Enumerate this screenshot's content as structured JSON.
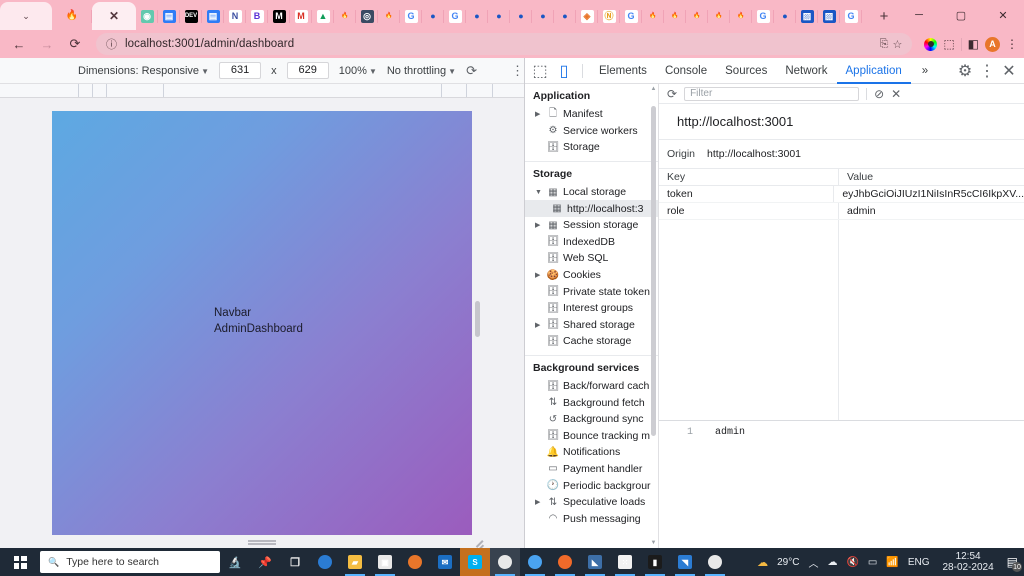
{
  "browser": {
    "tabs_left": [
      {
        "name": "tab-menu-chevron",
        "glyph": "⌄",
        "kind": "chevron"
      },
      {
        "name": "tab-pinned-1",
        "glyph": "🔥",
        "kind": "emoji"
      },
      {
        "name": "tab-active-close",
        "glyph": "✕",
        "kind": "close"
      }
    ],
    "pinned_tabs": [
      {
        "name": "tab-favicon-teal-circle",
        "label": "◉",
        "bg": "#63c9ae",
        "fg": "#ffffff"
      },
      {
        "name": "tab-favicon-docs-blue",
        "label": "▤",
        "bg": "#2f7cf6",
        "fg": "#ffffff"
      },
      {
        "name": "tab-favicon-dev-black",
        "label": "DEV",
        "bg": "#000000",
        "fg": "#ffffff"
      },
      {
        "name": "tab-favicon-docs-blue-2",
        "label": "▤",
        "bg": "#2f7cf6",
        "fg": "#ffffff"
      },
      {
        "name": "tab-favicon-notion-n",
        "label": "N",
        "bg": "#ffffff",
        "fg": "#3b4ea0"
      },
      {
        "name": "tab-favicon-bootstrap-b",
        "label": "B",
        "bg": "#ffffff",
        "fg": "#5b32d6"
      },
      {
        "name": "tab-favicon-medium-m",
        "label": "M",
        "bg": "#000000",
        "fg": "#ffffff"
      },
      {
        "name": "tab-favicon-gmail-m",
        "label": "M",
        "bg": "#ffffff",
        "fg": "#d93025"
      },
      {
        "name": "tab-favicon-google-drive",
        "label": "▲",
        "bg": "#ffffff",
        "fg": "#0f9d58"
      },
      {
        "name": "tab-favicon-fire-1",
        "label": "🔥",
        "bg": "transparent",
        "fg": "#e8762a"
      },
      {
        "name": "tab-favicon-camera-dark",
        "label": "◎",
        "bg": "#3b4a63",
        "fg": "#ffffff"
      },
      {
        "name": "tab-favicon-fire-2",
        "label": "🔥",
        "bg": "transparent",
        "fg": "#e8762a"
      },
      {
        "name": "tab-favicon-google-g-1",
        "label": "G",
        "bg": "#ffffff",
        "fg": "#4285f4"
      },
      {
        "name": "tab-favicon-blue-dot-1",
        "label": "●",
        "bg": "transparent",
        "fg": "#1a56c4"
      },
      {
        "name": "tab-favicon-google-g-2",
        "label": "G",
        "bg": "#ffffff",
        "fg": "#4285f4"
      },
      {
        "name": "tab-favicon-blue-dot-2",
        "label": "●",
        "bg": "transparent",
        "fg": "#1a56c4"
      },
      {
        "name": "tab-favicon-blue-dot-3",
        "label": "●",
        "bg": "transparent",
        "fg": "#1a56c4"
      },
      {
        "name": "tab-favicon-blue-dot-4",
        "label": "●",
        "bg": "transparent",
        "fg": "#1a56c4"
      },
      {
        "name": "tab-favicon-blue-dot-5",
        "label": "●",
        "bg": "transparent",
        "fg": "#1a56c4"
      },
      {
        "name": "tab-favicon-blue-dot-6",
        "label": "●",
        "bg": "transparent",
        "fg": "#1a56c4"
      },
      {
        "name": "tab-favicon-orange-diamond",
        "label": "◈",
        "bg": "#ffffff",
        "fg": "#e8762a"
      },
      {
        "name": "tab-favicon-orange-n",
        "label": "Ⓝ",
        "bg": "#ffffff",
        "fg": "#e8a020"
      },
      {
        "name": "tab-favicon-google-g-3",
        "label": "G",
        "bg": "#ffffff",
        "fg": "#4285f4"
      },
      {
        "name": "tab-favicon-fire-3",
        "label": "🔥",
        "bg": "transparent",
        "fg": "#e8a98d"
      },
      {
        "name": "tab-favicon-fire-4",
        "label": "🔥",
        "bg": "transparent",
        "fg": "#e8a98d"
      },
      {
        "name": "tab-favicon-fire-5",
        "label": "🔥",
        "bg": "transparent",
        "fg": "#e8a98d"
      },
      {
        "name": "tab-favicon-fire-6",
        "label": "🔥",
        "bg": "transparent",
        "fg": "#e8a98d"
      },
      {
        "name": "tab-favicon-fire-7",
        "label": "🔥",
        "bg": "transparent",
        "fg": "#e8a98d"
      },
      {
        "name": "tab-favicon-google-g-4",
        "label": "G",
        "bg": "#ffffff",
        "fg": "#4285f4"
      },
      {
        "name": "tab-favicon-blue-dot-7",
        "label": "●",
        "bg": "transparent",
        "fg": "#1a56c4"
      },
      {
        "name": "tab-favicon-blue-square-1",
        "label": "▨",
        "bg": "#1a56c4",
        "fg": "#ffffff"
      },
      {
        "name": "tab-favicon-blue-square-2",
        "label": "▨",
        "bg": "#1a56c4",
        "fg": "#ffffff"
      },
      {
        "name": "tab-favicon-google-g-5",
        "label": "G",
        "bg": "#ffffff",
        "fg": "#4285f4"
      },
      {
        "name": "tab-favicon-blue-dot-8",
        "label": "●",
        "bg": "transparent",
        "fg": "#1a56c4"
      },
      {
        "name": "tab-favicon-blue-dot-9",
        "label": "●",
        "bg": "transparent",
        "fg": "#1a56c4"
      }
    ],
    "new_tab_label": "+",
    "window_controls": {
      "minimize": "─",
      "maximize": "▢",
      "close": "✕"
    },
    "nav": {
      "back": "←",
      "forward": "→",
      "reload": "⟳"
    },
    "omnibox": {
      "site_info_icon": "ⓘ",
      "url": "localhost:3001/admin/dashboard",
      "cast_icon": "⎘",
      "bookmark_icon": "☆"
    },
    "extensions": {
      "puzzle_icon": "⬚",
      "split_icon": "◧",
      "profile_initial": "A",
      "menu_icon": "⋮"
    }
  },
  "device_toolbar": {
    "dimensions_label": "Dimensions: Responsive",
    "width": "631",
    "multiply": "x",
    "height": "629",
    "zoom": "100%",
    "throttling": "No throttling",
    "rotate_icon": "⟳",
    "more_icon": "⋮"
  },
  "page": {
    "navbar_text": "Navbar",
    "dashboard_text": "AdminDashboard"
  },
  "devtools": {
    "inspect_icon": "⬚",
    "device_icon": "▯",
    "tabs": [
      {
        "label": "Elements",
        "selected": false
      },
      {
        "label": "Console",
        "selected": false
      },
      {
        "label": "Sources",
        "selected": false
      },
      {
        "label": "Network",
        "selected": false
      },
      {
        "label": "Application",
        "selected": true
      }
    ],
    "overflow_label": "»",
    "settings_icon": "⚙",
    "more_icon": "⋮",
    "close_icon": "✕",
    "sidebar": {
      "section_application": "Application",
      "application_items": [
        {
          "label": "Manifest",
          "icon": "🗋",
          "arrow": true,
          "indent": false
        },
        {
          "label": "Service workers",
          "icon": "⚙",
          "arrow": false,
          "indent": false
        },
        {
          "label": "Storage",
          "icon": "🗄",
          "arrow": false,
          "indent": false
        }
      ],
      "section_storage": "Storage",
      "storage_items": [
        {
          "label": "Local storage",
          "icon": "▦",
          "arrow": true,
          "expanded": true,
          "indent": false,
          "selected": false
        },
        {
          "label": "http://localhost:3",
          "icon": "▦",
          "arrow": false,
          "indent": true,
          "selected": true
        },
        {
          "label": "Session storage",
          "icon": "▦",
          "arrow": true,
          "indent": false,
          "selected": false
        },
        {
          "label": "IndexedDB",
          "icon": "🗄",
          "arrow": false,
          "indent": false,
          "selected": false
        },
        {
          "label": "Web SQL",
          "icon": "🗄",
          "arrow": false,
          "indent": false,
          "selected": false
        },
        {
          "label": "Cookies",
          "icon": "🍪",
          "arrow": true,
          "indent": false,
          "selected": false
        },
        {
          "label": "Private state token",
          "icon": "🗄",
          "arrow": false,
          "indent": false,
          "selected": false
        },
        {
          "label": "Interest groups",
          "icon": "🗄",
          "arrow": false,
          "indent": false,
          "selected": false
        },
        {
          "label": "Shared storage",
          "icon": "🗄",
          "arrow": true,
          "indent": false,
          "selected": false
        },
        {
          "label": "Cache storage",
          "icon": "🗄",
          "arrow": false,
          "indent": false,
          "selected": false
        }
      ],
      "section_background": "Background services",
      "background_items": [
        {
          "label": "Back/forward cach",
          "icon": "🗄",
          "arrow": false
        },
        {
          "label": "Background fetch",
          "icon": "⇅",
          "arrow": false
        },
        {
          "label": "Background sync",
          "icon": "↺",
          "arrow": false
        },
        {
          "label": "Bounce tracking m",
          "icon": "🗄",
          "arrow": false
        },
        {
          "label": "Notifications",
          "icon": "🔔",
          "arrow": false
        },
        {
          "label": "Payment handler",
          "icon": "▭",
          "arrow": false
        },
        {
          "label": "Periodic backgrour",
          "icon": "🕐",
          "arrow": false
        },
        {
          "label": "Speculative loads",
          "icon": "⇅",
          "arrow": true
        },
        {
          "label": "Push messaging",
          "icon": "◠",
          "arrow": false
        }
      ]
    },
    "storage_panel": {
      "refresh_icon": "⟳",
      "filter_placeholder": "Filter",
      "clear_icon": "⊘",
      "delete_icon": "✕",
      "origin_title": "http://localhost:3001",
      "origin_label": "Origin",
      "origin_value": "http://localhost:3001",
      "columns": [
        "Key",
        "Value"
      ],
      "rows": [
        {
          "key": "token",
          "value": "eyJhbGciOiJIUzI1NiIsInR5cCI6IkpXV..."
        },
        {
          "key": "role",
          "value": "admin"
        }
      ],
      "preview": {
        "line_number": "1",
        "content": "admin"
      }
    }
  },
  "taskbar": {
    "search_placeholder": "Type here to search",
    "search_icon": "🔍",
    "items": [
      {
        "name": "taskbar-snip-icon",
        "glyph": "🔬",
        "bg": "transparent",
        "state": "none"
      },
      {
        "name": "taskbar-pin-icon",
        "glyph": "📌",
        "bg": "transparent",
        "state": "none"
      },
      {
        "name": "taskbar-task-view",
        "glyph": "❐",
        "bg": "transparent",
        "state": "none"
      },
      {
        "name": "taskbar-edge",
        "glyph": "●",
        "bg": "#2b7cd3",
        "state": "none"
      },
      {
        "name": "taskbar-file-explorer",
        "glyph": "▰",
        "bg": "#f5bd42",
        "state": "run"
      },
      {
        "name": "taskbar-microsoft-store",
        "glyph": "▣",
        "bg": "#e8e8e8",
        "state": "run"
      },
      {
        "name": "taskbar-firefox",
        "glyph": "●",
        "bg": "#e8762a",
        "state": "none"
      },
      {
        "name": "taskbar-mail",
        "glyph": "✉",
        "bg": "#1b6ec2",
        "state": "none"
      },
      {
        "name": "taskbar-skype",
        "glyph": "S",
        "bg": "#00aff0",
        "state": "hl"
      },
      {
        "name": "taskbar-chrome-active",
        "glyph": "◍",
        "bg": "#e8e8e8",
        "state": "active"
      },
      {
        "name": "taskbar-postman",
        "glyph": "◉",
        "bg": "#4aa3f0",
        "state": "run"
      },
      {
        "name": "taskbar-orange-app",
        "glyph": "⬤",
        "bg": "#f06a2a",
        "state": "run"
      },
      {
        "name": "taskbar-ms-app",
        "glyph": "◣",
        "bg": "#3d6fa8",
        "state": "run"
      },
      {
        "name": "taskbar-dice-app",
        "glyph": "⁙",
        "bg": "#f2f2f2",
        "state": "run"
      },
      {
        "name": "taskbar-terminal",
        "glyph": "▮",
        "bg": "#1b1b1b",
        "state": "run"
      },
      {
        "name": "taskbar-vscode",
        "glyph": "◥",
        "bg": "#2b7cd3",
        "state": "run"
      },
      {
        "name": "taskbar-chrome-2",
        "glyph": "◍",
        "bg": "#e8e8e8",
        "state": "run"
      }
    ],
    "tray": {
      "weather_icon": "☁",
      "temperature": "29°C",
      "show_hidden": "︿",
      "onedrive_icon": "☁",
      "volume_icon": "🔇",
      "battery_icon": "▭",
      "network_icon": "📶",
      "language": "ENG",
      "time": "12:54",
      "date": "28-02-2024",
      "notifications_icon": "▤",
      "notification_count": "10"
    }
  }
}
